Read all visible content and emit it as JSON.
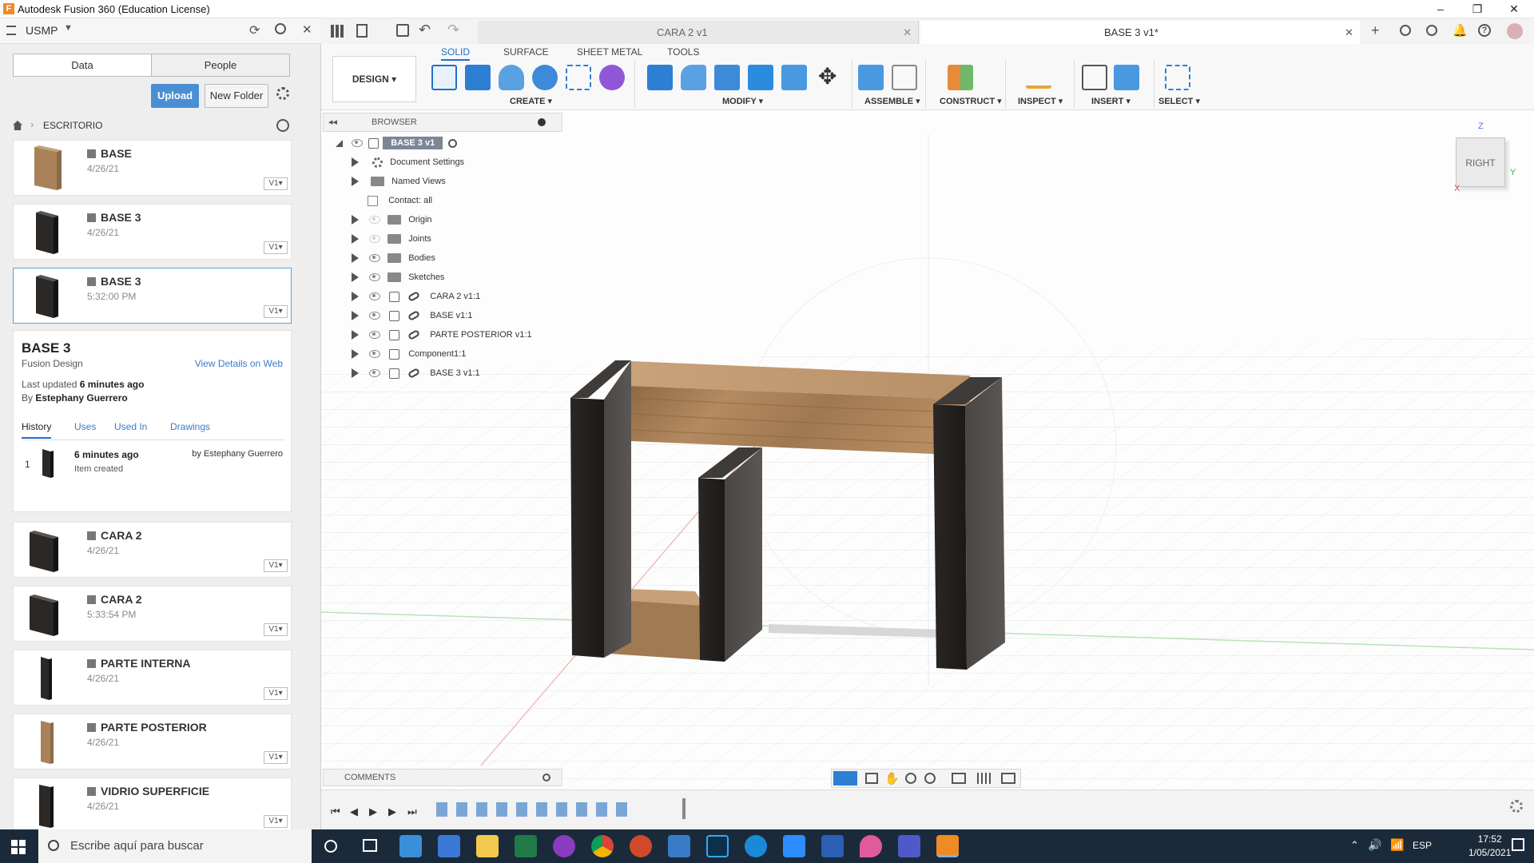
{
  "window": {
    "title": "Autodesk Fusion 360 (Education License)",
    "app_logo": "F"
  },
  "left_panel": {
    "team": "USMP",
    "tabs": [
      "Data",
      "People"
    ],
    "upload_label": "Upload",
    "new_folder_label": "New Folder",
    "breadcrumb": "ESCRITORIO",
    "files": [
      {
        "name": "BASE",
        "date": "4/26/21",
        "version": "V1",
        "thumb": "wood"
      },
      {
        "name": "BASE 3",
        "date": "4/26/21",
        "version": "V1",
        "thumb": "dark"
      },
      {
        "name": "BASE 3",
        "date": "5:32:00 PM",
        "version": "V1",
        "thumb": "dark",
        "selected": true
      }
    ],
    "details": {
      "title": "BASE 3",
      "type": "Fusion Design",
      "view_link": "View Details on Web",
      "updated_prefix": "Last updated",
      "updated_value": "6 minutes ago",
      "by_prefix": "By",
      "author": "Estephany Guerrero",
      "tabs": [
        "History",
        "Uses",
        "Used In",
        "Drawings"
      ],
      "history": {
        "num": "1",
        "when": "6 minutes ago",
        "by": "by Estephany Guerrero",
        "action": "Item created"
      }
    },
    "files_below": [
      {
        "name": "CARA 2",
        "date": "4/26/21",
        "version": "V1",
        "thumb": "dark"
      },
      {
        "name": "CARA 2",
        "date": "5:33:54 PM",
        "version": "V1",
        "thumb": "dark"
      },
      {
        "name": "PARTE INTERNA",
        "date": "4/26/21",
        "version": "V1",
        "thumb": "dark-thin"
      },
      {
        "name": "PARTE POSTERIOR",
        "date": "4/26/21",
        "version": "V1",
        "thumb": "wood-thin"
      },
      {
        "name": "VIDRIO SUPERFICIE",
        "date": "4/26/21",
        "version": "V1",
        "thumb": "dark-thin"
      }
    ]
  },
  "doc_tabs": [
    {
      "label": "CARA 2 v1",
      "active": false
    },
    {
      "label": "BASE 3 v1*",
      "active": true
    }
  ],
  "ribbon": {
    "tabs": [
      "SOLID",
      "SURFACE",
      "SHEET METAL",
      "TOOLS"
    ],
    "workspace": "DESIGN",
    "groups": [
      "CREATE",
      "MODIFY",
      "ASSEMBLE",
      "CONSTRUCT",
      "INSPECT",
      "INSERT",
      "SELECT"
    ]
  },
  "browser": {
    "header": "BROWSER",
    "root": "BASE 3 v1",
    "items": [
      {
        "label": "Document Settings",
        "icon": "gear-icon"
      },
      {
        "label": "Named Views",
        "icon": "folder-icon"
      },
      {
        "label": "Contact: all",
        "icon": "contact-icon"
      },
      {
        "label": "Origin",
        "icon": "folder-icon"
      },
      {
        "label": "Joints",
        "icon": "folder-icon"
      },
      {
        "label": "Bodies",
        "icon": "folder-icon"
      },
      {
        "label": "Sketches",
        "icon": "folder-icon"
      },
      {
        "label": "CARA 2 v1:1",
        "icon": "link-icon"
      },
      {
        "label": "BASE v1:1",
        "icon": "link-icon"
      },
      {
        "label": "PARTE POSTERIOR v1:1",
        "icon": "link-icon"
      },
      {
        "label": "Component1:1",
        "icon": "component-icon"
      },
      {
        "label": "BASE 3 v1:1",
        "icon": "link-icon"
      }
    ]
  },
  "viewcube": {
    "face": "RIGHT",
    "axis_z": "Z",
    "axis_y": "Y",
    "axis_x": "X"
  },
  "comments_label": "COMMENTS",
  "taskbar": {
    "search_placeholder": "Escribe aquí para buscar",
    "lang": "ESP",
    "time": "17:52",
    "date": "1/05/2021"
  },
  "colors": {
    "accent": "#1e6fc9",
    "upload": "#4a8fd4",
    "wood": "#a9825a",
    "dark_wood": "#2b2826"
  }
}
